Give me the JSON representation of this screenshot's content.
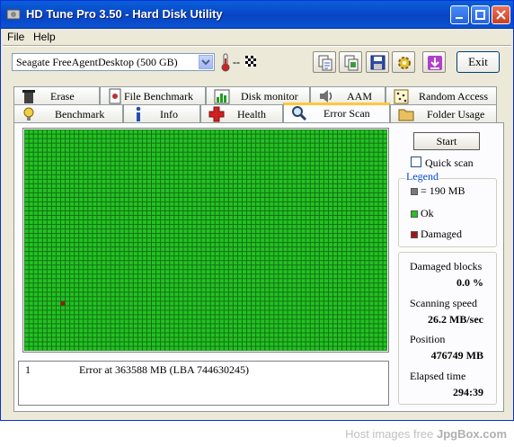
{
  "window": {
    "title": "HD Tune Pro 3.50 - Hard Disk Utility"
  },
  "menu": {
    "file": "File",
    "help": "Help"
  },
  "toolbar": {
    "drive": "Seagate FreeAgentDesktop (500 GB)",
    "temperature": "--",
    "exit_label": "Exit"
  },
  "tabs_top": [
    {
      "label": "Erase",
      "icon": "trash-icon"
    },
    {
      "label": "File Benchmark",
      "icon": "file-benchmark-icon"
    },
    {
      "label": "Disk monitor",
      "icon": "chart-icon"
    },
    {
      "label": "AAM",
      "icon": "speaker-icon"
    },
    {
      "label": "Random Access",
      "icon": "dots-grid-icon"
    }
  ],
  "tabs_bottom": [
    {
      "label": "Benchmark",
      "icon": "bulb-icon"
    },
    {
      "label": "Info",
      "icon": "info-icon"
    },
    {
      "label": "Health",
      "icon": "health-cross-icon"
    },
    {
      "label": "Error Scan",
      "icon": "magnifier-icon",
      "active": true
    },
    {
      "label": "Folder Usage",
      "icon": "folder-icon"
    }
  ],
  "scan": {
    "start_label": "Start",
    "quick_scan_label": "Quick scan",
    "quick_scan_checked": false,
    "grid": {
      "columns": 80,
      "rows": 49,
      "damaged": [
        [
          8,
          38
        ]
      ]
    },
    "colors": {
      "ok": "#22c322",
      "damaged": "#a31515",
      "grid_line": "#157015"
    }
  },
  "legend": {
    "title": "Legend",
    "items": [
      {
        "label": "= 190 MB",
        "color": "#7a7a7a"
      },
      {
        "label": "Ok",
        "color": "#22c322"
      },
      {
        "label": "Damaged",
        "color": "#a31515"
      }
    ]
  },
  "stats": {
    "damaged_label": "Damaged blocks",
    "damaged_value": "0.0 %",
    "speed_label": "Scanning speed",
    "speed_value": "26.2 MB/sec",
    "position_label": "Position",
    "position_value": "476749 MB",
    "elapsed_label": "Elapsed time",
    "elapsed_value": "294:39"
  },
  "log": [
    {
      "num": "1",
      "message": "Error at 363588 MB (LBA 744630245)"
    }
  ],
  "watermark": {
    "prefix": "Host images free",
    "brand": "JpgBox.com"
  }
}
